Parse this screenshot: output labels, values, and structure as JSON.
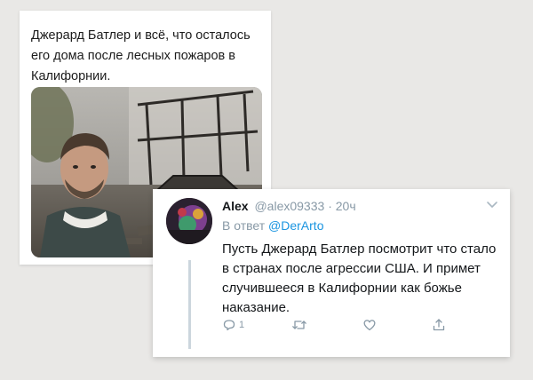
{
  "background_tweet": {
    "text": "Джерард Батлер и всё, что осталось его дома после лесных пожаров в Калифорнии.",
    "image": "selfie-in-burned-house"
  },
  "reply_tweet": {
    "name": "Alex",
    "handle": "@alex09333",
    "separator": "·",
    "time": "20ч",
    "reply_prefix": "В ответ",
    "reply_mention": "@DerArto",
    "text": "Пусть Джерард Батлер  посмотрит что стало в странах после агрессии США. И примет случившееся в Калифорнии как божье наказание.",
    "reply_count": "1",
    "icons": {
      "reply": "reply-icon",
      "retweet": "retweet-icon",
      "like": "heart-icon",
      "share": "share-icon",
      "menu": "chevron-down-icon"
    },
    "colors": {
      "link": "#1b95e0",
      "muted": "#8899a6",
      "text": "#14171a"
    }
  }
}
